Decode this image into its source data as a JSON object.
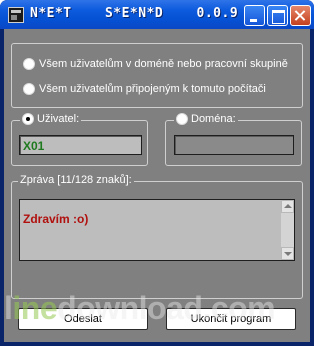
{
  "window": {
    "title": "N*E*T    S*E*N*D    0.0.9",
    "buttons": {
      "minimize_icon": "minimize-icon",
      "maximize_icon": "maximize-icon",
      "close_icon": "close-icon"
    }
  },
  "recipients": {
    "options": [
      {
        "label": "Všem uživatelům v doméně nebo pracovní skupině",
        "checked": false
      },
      {
        "label": "Všem uživatelům připojeným k tomuto počítači",
        "checked": false
      }
    ]
  },
  "user": {
    "label": "Uživatel:",
    "checked": true,
    "value": "X01"
  },
  "domain": {
    "label": "Doména:",
    "checked": false,
    "value": ""
  },
  "message": {
    "label": "Zpráva [11/128 znaků]:",
    "text": "Zdravím :o)"
  },
  "actions": {
    "send_label": "Odeslat",
    "quit_label": "Ukončit program"
  },
  "watermark": {
    "prefix": "l",
    "accent": "ine",
    "suffix": "download.com"
  },
  "colors": {
    "titlebar": "#0550d3",
    "client_bg": "#808080",
    "user_value": "#1f7a1f",
    "message_text": "#b0100e"
  }
}
